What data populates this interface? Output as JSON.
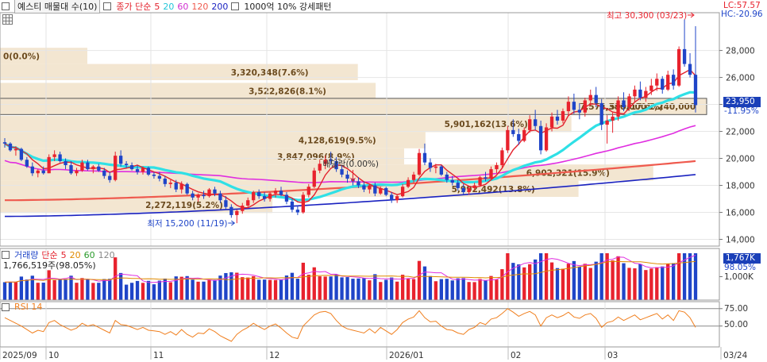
{
  "legend": {
    "title": "예스티 매물대 수(10)",
    "ma_prefix": "종가 단순",
    "ma_5": "5",
    "ma_20": "20",
    "ma_60": "60",
    "ma_120": "120",
    "ma_200": "200",
    "pattern": "1000억 10% 강세패턴"
  },
  "right_tags": {
    "lc": "LC:57.57",
    "hc": "HC:-20.96",
    "current_price": "23,950",
    "current_change": "-11.95%"
  },
  "annotations": {
    "high": "최고 30,300 (03/23)",
    "low": "최저 15,200 (11/19)",
    "dividend": "배당락(0.00%)"
  },
  "volume_panel": {
    "label": "거래량",
    "ma_prefix": "단순",
    "ma_5": "5",
    "ma_20": "20",
    "ma_60": "60",
    "ma_120": "120",
    "value_text": "1,766,519주(98.05%)",
    "tag_value": "1,767K",
    "tag_pct": "98.05%",
    "axis_label": "1,000K"
  },
  "rsi_panel": {
    "label": "RSI 14",
    "ticks": [
      "75.00",
      "50.00"
    ]
  },
  "colors": {
    "up": "#e8222d",
    "down": "#1f45c8",
    "ma5": "#e3222d",
    "ma20": "#2fe0e6",
    "ma60": "#e02ee0",
    "ma120": "#ef5a4e",
    "ma200": "#1a22c0",
    "volume_zone": "#f3e6d1",
    "rsi": "#f07f1e"
  },
  "chart_data": {
    "type": "candlestick",
    "y_axis": {
      "ticks": [
        "14,000",
        "16,000",
        "18,000",
        "20,000",
        "22,000",
        "24,000",
        "26,000",
        "28,000"
      ],
      "ylim": [
        13500,
        30800
      ]
    },
    "x_labels": [
      "2025/09",
      "10",
      "11",
      "12",
      "2026/01",
      "02",
      "03",
      "03/24"
    ],
    "volume_profile": [
      {
        "label": "0(0.0%)",
        "price": 27600,
        "pct": 0.0
      },
      {
        "label": "3,320,348(7.6%)",
        "price": 26400,
        "pct": 7.6
      },
      {
        "label": "3,522,826(8.1%)",
        "price": 25000,
        "pct": 8.1
      },
      {
        "label": "7,573,599(17.4%)",
        "price": 23850,
        "pct": 17.4
      },
      {
        "label": "5,901,162(13.6%)",
        "price": 22550,
        "pct": 13.6
      },
      {
        "label": "4,128,619(9.5%)",
        "price": 21350,
        "pct": 9.5
      },
      {
        "label": "3,847,096(8.9%)",
        "price": 20150,
        "pct": 8.9
      },
      {
        "label": "6,902,321(15.9%)",
        "price": 18950,
        "pct": 15.9
      },
      {
        "label": "5,992,492(13.8%)",
        "price": 17750,
        "pct": 13.8
      },
      {
        "label": "2,272,119(5.2%)",
        "price": 16550,
        "pct": 5.2
      }
    ],
    "overlap_label": "2,380,000",
    "overlap_label2": "1,240,000",
    "candles": [
      [
        21200,
        21500,
        20800,
        21100
      ],
      [
        21100,
        21200,
        20500,
        20600
      ],
      [
        20600,
        20900,
        20200,
        20700
      ],
      [
        20700,
        20800,
        19800,
        19900
      ],
      [
        19900,
        20100,
        19300,
        19400
      ],
      [
        19400,
        19700,
        18700,
        18900
      ],
      [
        18900,
        19200,
        18600,
        19100
      ],
      [
        19100,
        19400,
        18800,
        18900
      ],
      [
        18900,
        20300,
        18900,
        20100
      ],
      [
        20100,
        20600,
        19800,
        20300
      ],
      [
        20300,
        20500,
        19700,
        19800
      ],
      [
        19800,
        20000,
        19200,
        19500
      ],
      [
        19500,
        19800,
        18800,
        18900
      ],
      [
        18900,
        19300,
        18700,
        19100
      ],
      [
        19100,
        19900,
        19000,
        19700
      ],
      [
        19700,
        19900,
        19100,
        19200
      ],
      [
        19200,
        19500,
        18900,
        19400
      ],
      [
        19400,
        19600,
        19000,
        19100
      ],
      [
        19100,
        19300,
        18500,
        18700
      ],
      [
        18700,
        19000,
        18200,
        18400
      ],
      [
        18400,
        20500,
        18300,
        20200
      ],
      [
        20200,
        20600,
        19400,
        19600
      ],
      [
        19600,
        19800,
        19300,
        19500
      ],
      [
        19500,
        19700,
        19100,
        19200
      ],
      [
        19200,
        19500,
        18800,
        19000
      ],
      [
        19000,
        19400,
        18800,
        19300
      ],
      [
        19300,
        19400,
        18700,
        18800
      ],
      [
        18800,
        19000,
        18500,
        18700
      ],
      [
        18700,
        19000,
        18300,
        18500
      ],
      [
        18500,
        18700,
        17900,
        18100
      ],
      [
        18100,
        18400,
        17800,
        18200
      ],
      [
        18200,
        18400,
        17500,
        17700
      ],
      [
        17700,
        18300,
        17400,
        18100
      ],
      [
        18100,
        18200,
        17300,
        17400
      ],
      [
        17400,
        17600,
        16900,
        17100
      ],
      [
        17100,
        17400,
        16800,
        17300
      ],
      [
        17300,
        17600,
        17000,
        17200
      ],
      [
        17200,
        17800,
        17100,
        17700
      ],
      [
        17700,
        17900,
        17200,
        17400
      ],
      [
        17400,
        17600,
        16700,
        16900
      ],
      [
        16900,
        17200,
        16200,
        16400
      ],
      [
        16400,
        16600,
        15600,
        15800
      ],
      [
        15800,
        16200,
        15200,
        16100
      ],
      [
        16100,
        16700,
        15900,
        16500
      ],
      [
        16500,
        17100,
        16300,
        16900
      ],
      [
        16900,
        17600,
        16700,
        17500
      ],
      [
        17500,
        17700,
        17000,
        17200
      ],
      [
        17200,
        17500,
        16800,
        17000
      ],
      [
        17000,
        17500,
        16800,
        17400
      ],
      [
        17400,
        17800,
        17100,
        17600
      ],
      [
        17600,
        17900,
        17200,
        17300
      ],
      [
        17300,
        17500,
        16600,
        16800
      ],
      [
        16800,
        17000,
        16000,
        16200
      ],
      [
        16200,
        16500,
        15800,
        16000
      ],
      [
        16000,
        17500,
        15900,
        17300
      ],
      [
        17300,
        18100,
        17100,
        17900
      ],
      [
        17900,
        19300,
        17800,
        19100
      ],
      [
        19100,
        19900,
        18900,
        19600
      ],
      [
        19600,
        20200,
        19200,
        19900
      ],
      [
        19900,
        20500,
        19500,
        19800
      ],
      [
        19800,
        20100,
        19000,
        19200
      ],
      [
        19200,
        19500,
        18600,
        18800
      ],
      [
        18800,
        19100,
        18200,
        18500
      ],
      [
        18500,
        18800,
        18000,
        18300
      ],
      [
        18300,
        18600,
        17800,
        18000
      ],
      [
        18000,
        18300,
        17500,
        17700
      ],
      [
        17700,
        18100,
        17400,
        18000
      ],
      [
        18000,
        18200,
        17200,
        17400
      ],
      [
        17400,
        17900,
        17300,
        17800
      ],
      [
        17800,
        17900,
        17200,
        17300
      ],
      [
        17300,
        17500,
        16700,
        16900
      ],
      [
        16900,
        17300,
        16700,
        17200
      ],
      [
        17200,
        18100,
        17100,
        17900
      ],
      [
        17900,
        18600,
        17800,
        18400
      ],
      [
        18400,
        19000,
        18200,
        18800
      ],
      [
        18800,
        20700,
        18700,
        20400
      ],
      [
        20400,
        21100,
        19500,
        19700
      ],
      [
        19700,
        20000,
        19000,
        19300
      ],
      [
        19300,
        19600,
        18900,
        19400
      ],
      [
        19400,
        19500,
        18700,
        18800
      ],
      [
        18800,
        19000,
        18200,
        18400
      ],
      [
        18400,
        18700,
        18000,
        18200
      ],
      [
        18200,
        18400,
        17600,
        17800
      ],
      [
        17800,
        18100,
        17300,
        17500
      ],
      [
        17500,
        17900,
        17300,
        17800
      ],
      [
        17800,
        18200,
        17600,
        18000
      ],
      [
        18000,
        18700,
        17900,
        18600
      ],
      [
        18600,
        19000,
        18300,
        18500
      ],
      [
        18500,
        19400,
        18400,
        19200
      ],
      [
        19200,
        19700,
        18900,
        19500
      ],
      [
        19500,
        20800,
        19300,
        20600
      ],
      [
        20600,
        22400,
        20400,
        22100
      ],
      [
        22100,
        22900,
        21600,
        21800
      ],
      [
        21800,
        22200,
        21000,
        21300
      ],
      [
        21300,
        22300,
        21200,
        22100
      ],
      [
        22100,
        23200,
        21900,
        22900
      ],
      [
        22900,
        23600,
        22100,
        22400
      ],
      [
        22400,
        22800,
        20300,
        20600
      ],
      [
        20600,
        22600,
        20500,
        22300
      ],
      [
        22300,
        23400,
        22000,
        23100
      ],
      [
        23100,
        23600,
        22500,
        22800
      ],
      [
        22800,
        23700,
        22600,
        23500
      ],
      [
        23500,
        24600,
        23200,
        24200
      ],
      [
        24200,
        24800,
        23300,
        23600
      ],
      [
        23600,
        24100,
        22900,
        23400
      ],
      [
        23400,
        24500,
        23100,
        24300
      ],
      [
        24300,
        25100,
        23900,
        24700
      ],
      [
        24700,
        25300,
        23800,
        24100
      ],
      [
        24100,
        24400,
        22100,
        22500
      ],
      [
        22500,
        23200,
        21100,
        22800
      ],
      [
        22800,
        23400,
        21900,
        23100
      ],
      [
        23100,
        24600,
        22800,
        24300
      ],
      [
        24300,
        24900,
        23500,
        23800
      ],
      [
        23800,
        24800,
        23600,
        24600
      ],
      [
        24600,
        25400,
        24200,
        25100
      ],
      [
        25100,
        25700,
        24300,
        24500
      ],
      [
        24500,
        25300,
        24200,
        25000
      ],
      [
        25000,
        25900,
        24700,
        25400
      ],
      [
        25400,
        26300,
        25000,
        25900
      ],
      [
        25900,
        26100,
        24800,
        25100
      ],
      [
        25100,
        26500,
        25000,
        26200
      ],
      [
        26200,
        26600,
        25100,
        25400
      ],
      [
        25400,
        28300,
        25300,
        28100
      ],
      [
        28100,
        30300,
        26800,
        27000
      ],
      [
        27000,
        27800,
        26000,
        26200
      ],
      [
        26200,
        29800,
        23400,
        23950
      ]
    ],
    "rsi_values": [
      62,
      58,
      54,
      50,
      45,
      40,
      44,
      42,
      55,
      58,
      52,
      48,
      44,
      47,
      54,
      50,
      52,
      48,
      44,
      40,
      58,
      52,
      51,
      48,
      45,
      48,
      44,
      43,
      42,
      38,
      42,
      37,
      45,
      38,
      34,
      40,
      39,
      46,
      42,
      36,
      32,
      28,
      38,
      44,
      48,
      54,
      49,
      45,
      50,
      53,
      47,
      40,
      34,
      32,
      50,
      58,
      66,
      70,
      71,
      68,
      58,
      50,
      46,
      44,
      42,
      40,
      46,
      40,
      48,
      43,
      38,
      45,
      55,
      60,
      63,
      72,
      62,
      56,
      57,
      50,
      45,
      44,
      40,
      38,
      45,
      48,
      55,
      52,
      60,
      62,
      68,
      75,
      70,
      64,
      68,
      71,
      66,
      50,
      62,
      66,
      62,
      65,
      70,
      63,
      61,
      66,
      68,
      61,
      48,
      55,
      57,
      63,
      58,
      62,
      66,
      59,
      62,
      65,
      68,
      60,
      66,
      58,
      72,
      70,
      62,
      48
    ]
  }
}
